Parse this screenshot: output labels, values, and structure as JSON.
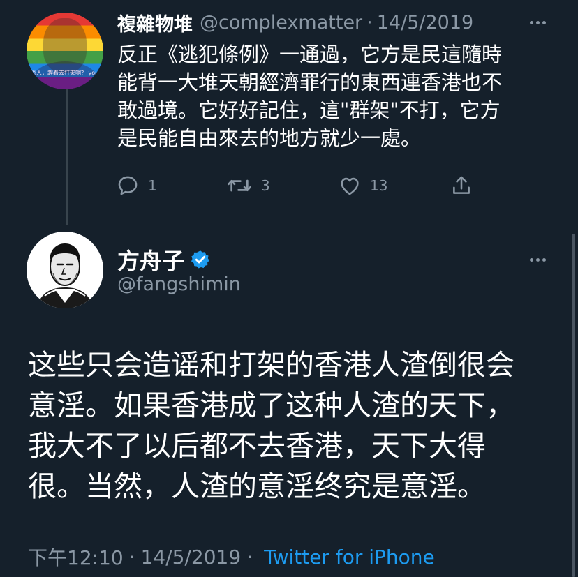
{
  "reply_tweet": {
    "display_name": "複雜物堆",
    "handle": "@complexmatter",
    "separator": "·",
    "date": "14/5/2019",
    "avatar_caption": "係人，趕着去打架嗰？ you hurrying to",
    "text": "反正《逃犯條例》一通過，它方是民這隨時\n能背一大堆天朝經濟罪行的東西連香港也不\n敢過境。它好好記住，這\"群架\"不打，它方\n是民能自由來去的地方就少一處。",
    "actions": {
      "reply_count": "1",
      "retweet_count": "3",
      "like_count": "13"
    }
  },
  "main_tweet": {
    "display_name": "方舟子",
    "verified": true,
    "handle": "@fangshimin",
    "text": "这些只会造谣和打架的香港人渣倒很会\n意淫。如果香港成了这种人渣的天下，\n我大不了以后都不去香港，天下大得\n很。当然，人渣的意淫终究是意淫。",
    "time": "下午12:10",
    "separator": "·",
    "date": "14/5/2019",
    "source": "Twitter for iPhone"
  },
  "colors": {
    "background": "#15202b",
    "primary_text": "#ffffff",
    "secondary_text": "#8b98a5",
    "accent": "#1d9bf0"
  },
  "icons": {
    "reply": "speech-bubble-icon",
    "retweet": "retweet-arrows-icon",
    "like": "heart-icon",
    "share": "share-upload-icon",
    "more": "three-dots-icon",
    "verified": "verified-badge-icon"
  }
}
